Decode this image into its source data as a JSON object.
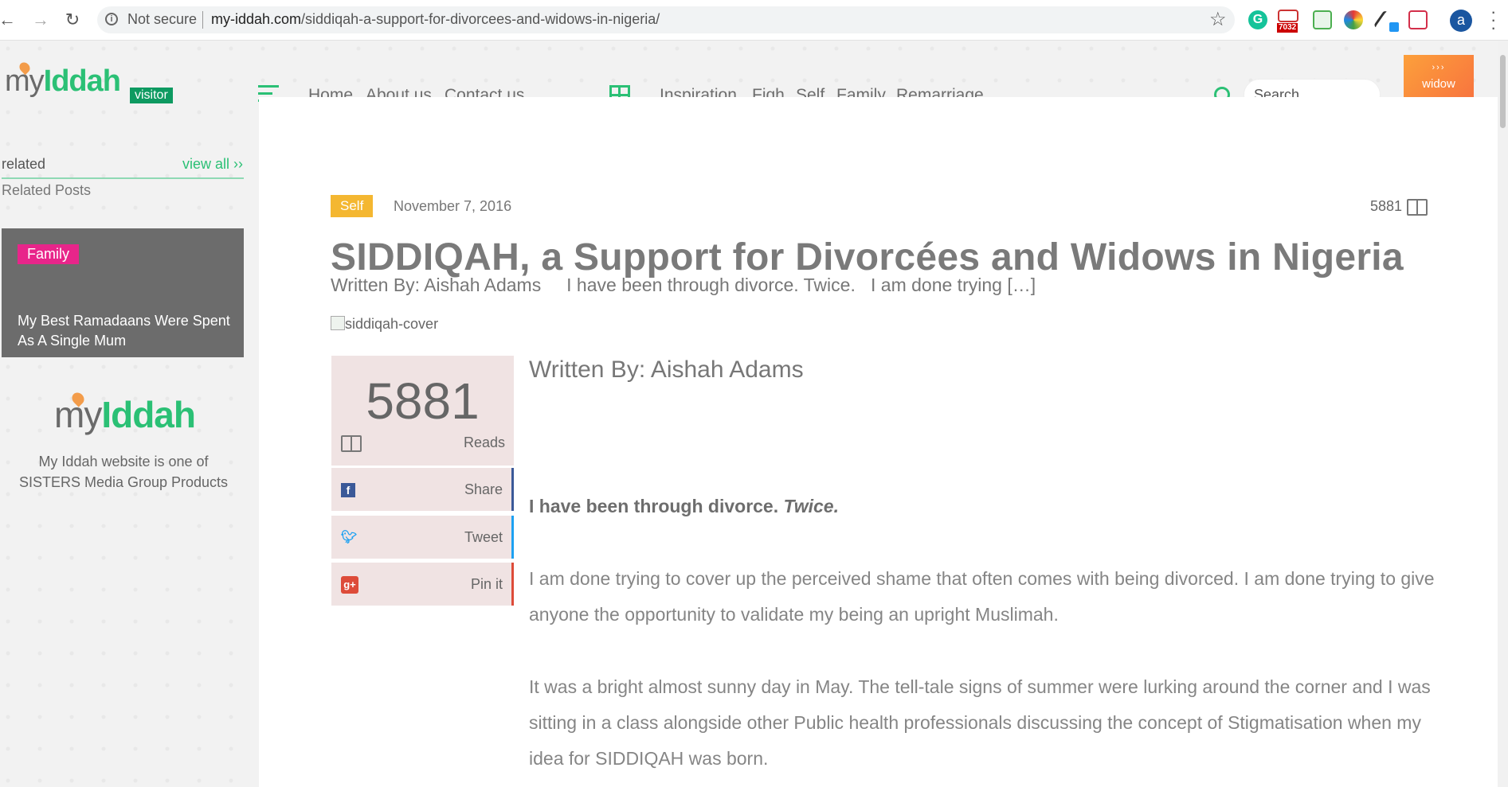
{
  "browser": {
    "back": "←",
    "forward": "→",
    "reload": "↻",
    "security_label": "Not secure",
    "url_domain": "my-iddah.com",
    "url_path": "/siddiqah-a-support-for-divorcees-and-widows-in-nigeria/",
    "gmail_count": "7032",
    "profile_initial": "a",
    "icons": [
      "star-icon",
      "grammarly-icon",
      "gmail-icon",
      "extension-icon",
      "rainbow-extension-icon",
      "eyedropper-icon",
      "pocket-icon"
    ]
  },
  "header": {
    "logo_my": "my",
    "logo_iddah": "Iddah",
    "visitor_badge": "visitor",
    "nav": [
      "Home",
      "About us",
      "Contact us"
    ],
    "categories": [
      "Inspiration",
      "Fiqh",
      "Self",
      "Family",
      "Remarriage"
    ],
    "search_placeholder": "Search",
    "widow_arrows": "›››",
    "widow_label": "widow"
  },
  "sidebar": {
    "related": "related",
    "view_all": "view all ››",
    "subtitle": "Related Posts",
    "card": {
      "tag": "Family",
      "title": "My Best Ramadaans Were Spent As A Single Mum",
      "tag_color": "#e8258a"
    },
    "logo_my": "my",
    "logo_iddah": "Iddah",
    "about": "My Iddah website is one of SISTERS Media Group Products"
  },
  "post": {
    "category": "Self",
    "date": "November 7, 2016",
    "reads_count": "5881",
    "title": "SIDDIQAH, a Support for Divorcées and Widows in Nigeria",
    "excerpt": "Written By: Aishah Adams     I have been through divorce. Twice.   I am done trying […]",
    "image_alt": "siddiqah-cover",
    "counter_num": "5881",
    "counter_label": "Reads",
    "share": [
      {
        "label": "Share",
        "icon": "f",
        "color": "#3b5998"
      },
      {
        "label": "Tweet",
        "icon": "t",
        "color": "#1da1f2"
      },
      {
        "label": "Pin it",
        "icon": "g+",
        "color": "#dd4b39"
      }
    ],
    "byline": "Written By: Aishah Adams",
    "lead_plain": "I have been through divorce. ",
    "lead_italic": "Twice.",
    "paragraphs": [
      "I am done trying to cover up the perceived shame that often comes with being divorced. I am done trying to give anyone the opportunity to validate my being an upright Muslimah.",
      "It was a bright almost sunny day in May. The tell-tale signs of summer were lurking around the corner and I was sitting in a class alongside other Public health professionals discussing the concept of Stigmatisation when my idea for SIDDIQAH was born."
    ]
  },
  "colors": {
    "accent": "#2bc075",
    "category_self": "#f4b731",
    "widow_gradient_start": "#fca03b",
    "widow_gradient_end": "#f76a3f"
  }
}
